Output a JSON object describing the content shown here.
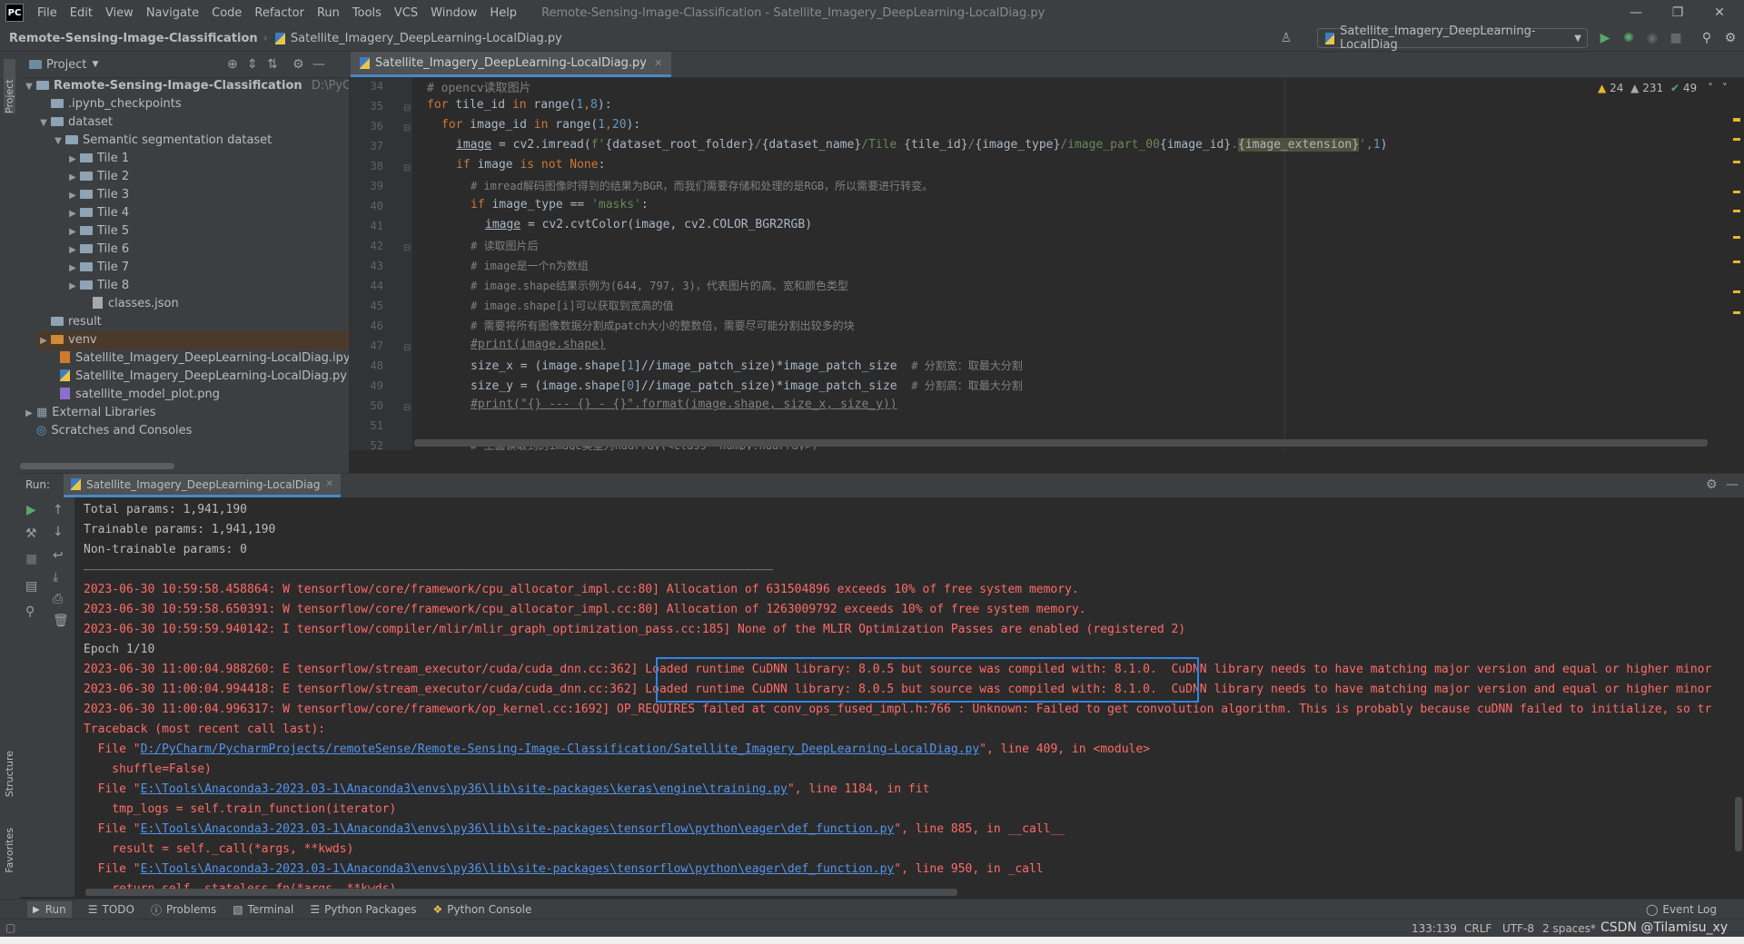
{
  "menu": {
    "items": [
      "File",
      "Edit",
      "View",
      "Navigate",
      "Code",
      "Refactor",
      "Run",
      "Tools",
      "VCS",
      "Window",
      "Help"
    ],
    "window_title": "Remote-Sensing-Image-Classification - Satellite_Imagery_DeepLearning-LocalDiag.py"
  },
  "navbar": {
    "project": "Remote-Sensing-Image-Classification",
    "file": "Satellite_Imagery_DeepLearning-LocalDiag.py",
    "run_config": "Satellite_Imagery_DeepLearning-LocalDiag"
  },
  "side_tabs": {
    "project": "Project",
    "structure": "Structure",
    "favorites": "Favorites"
  },
  "project_panel": {
    "title": "Project",
    "root_name": "Remote-Sensing-Image-Classification",
    "root_path": "D:\\PyCharm\\Py",
    "items": {
      "checkpoints": ".ipynb_checkpoints",
      "dataset": "dataset",
      "semantic": "Semantic segmentation dataset",
      "tile1": "Tile 1",
      "tile2": "Tile 2",
      "tile3": "Tile 3",
      "tile4": "Tile 4",
      "tile5": "Tile 5",
      "tile6": "Tile 6",
      "tile7": "Tile 7",
      "tile8": "Tile 8",
      "classes": "classes.json",
      "result": "result",
      "venv": "venv",
      "ipynb": "Satellite_Imagery_DeepLearning-LocalDiag.ipynb",
      "py": "Satellite_Imagery_DeepLearning-LocalDiag.py",
      "png": "satellite_model_plot.png",
      "ext_libs": "External Libraries",
      "scratches": "Scratches and Consoles"
    }
  },
  "editor": {
    "tab": "Satellite_Imagery_DeepLearning-LocalDiag.py",
    "inspections": {
      "warn1": "24",
      "warn2": "231",
      "ok": "49"
    },
    "line_numbers": [
      "34",
      "35",
      "36",
      "37",
      "38",
      "39",
      "40",
      "41",
      "42",
      "43",
      "44",
      "45",
      "46",
      "47",
      "48",
      "49",
      "50",
      "51",
      "52"
    ],
    "lines": {
      "l34": "# opencv读取图片",
      "l35_a": "for",
      "l35_b": " tile_id ",
      "l35_c": "in",
      "l35_d": " range(",
      "l35_e": "1",
      "l35_f": ",",
      "l35_g": "8",
      "l35_h": "):",
      "l36_a": "for",
      "l36_b": " image_id ",
      "l36_c": "in",
      "l36_d": " range(",
      "l36_e": "1",
      "l36_f": ",",
      "l36_g": "20",
      "l36_h": "):",
      "l37_a": "image",
      "l37_b": " = cv2.imread(",
      "l37_c": "f'",
      "l37_d": "{dataset_root_folder}",
      "l37_e": "/",
      "l37_f": "{dataset_name}",
      "l37_g": "/Tile ",
      "l37_h": "{tile_id}",
      "l37_i": "/",
      "l37_j": "{image_type}",
      "l37_k": "/image_part_00",
      "l37_l": "{image_id}",
      "l37_m": ".",
      "l37_n": "{image_extension}",
      "l37_o": "'",
      "l37_p": ",",
      "l37_q": "1",
      "l37_r": ")",
      "l38_a": "if",
      "l38_b": " image ",
      "l38_c": "is not",
      "l38_d": " None",
      "l38_e": ":",
      "l39": "# imread解码图像时得到的结果为BGR，而我们需要存储和处理的是RGB，所以需要进行转变。",
      "l40_a": "if",
      "l40_b": " image_type == ",
      "l40_c": "'masks'",
      "l40_d": ":",
      "l41_a": "image",
      "l41_b": " = cv2.cvtColor(image, cv2.COLOR_BGR2RGB)",
      "l42": "# 读取图片后",
      "l43": "# image是一个n为数组",
      "l44": "# image.shape结果示例为(644, 797, 3)，代表图片的高、宽和颜色类型",
      "l45": "# image.shape[i]可以获取到宽高的值",
      "l46": "# 需要将所有图像数据分割成patch大小的整数倍，需要尽可能分割出较多的块",
      "l47": "#print(image.shape)",
      "l48_a": "size_x = (image.shape[",
      "l48_b": "1",
      "l48_c": "]//image_patch_size)*image_patch_size  ",
      "l48_d": "# 分割宽：取最大分割",
      "l49_a": "size_y = (image.shape[",
      "l49_b": "0",
      "l49_c": "]//image_patch_size)*image_patch_size  ",
      "l49_d": "# 分割高：取最大分割",
      "l50": "#print(\"{} --- {} - {}\".format(image.shape, size_x, size_y))",
      "l52": "# 上面读取到的image类型为ndarray(<class 'numpy.ndarray>)"
    }
  },
  "run_panel": {
    "label": "Run:",
    "tab": "Satellite_Imagery_DeepLearning-LocalDiag",
    "output": {
      "o1": "Total params: 1,941,190",
      "o2": "Trainable params: 1,941,190",
      "o3": "Non-trainable params: 0",
      "o4": "_________________________________________________________________________________________________",
      "o5": "2023-06-30 10:59:58.458864: W tensorflow/core/framework/cpu_allocator_impl.cc:80] Allocation of 631504896 exceeds 10% of free system memory.",
      "o6": "2023-06-30 10:59:58.650391: W tensorflow/core/framework/cpu_allocator_impl.cc:80] Allocation of 1263009792 exceeds 10% of free system memory.",
      "o7": "2023-06-30 10:59:59.940142: I tensorflow/compiler/mlir/mlir_graph_optimization_pass.cc:185] None of the MLIR Optimization Passes are enabled (registered 2)",
      "o8": "Epoch 1/10",
      "o9": "2023-06-30 11:00:04.988260: E tensorflow/stream_executor/cuda/cuda_dnn.cc:362] Loaded runtime CuDNN library: 8.0.5 but source was compiled with: 8.1.0.  CuDNN library needs to have matching major version and equal or higher minor",
      "o10": "2023-06-30 11:00:04.994418: E tensorflow/stream_executor/cuda/cuda_dnn.cc:362] Loaded runtime CuDNN library: 8.0.5 but source was compiled with: 8.1.0.  CuDNN library needs to have matching major version and equal or higher minor",
      "o11": "2023-06-30 11:00:04.996317: W tensorflow/core/framework/op_kernel.cc:1692] OP_REQUIRES failed at conv_ops_fused_impl.h:766 : Unknown: Failed to get convolution algorithm. This is probably because cuDNN failed to initialize, so tr",
      "o12": "Traceback (most recent call last):",
      "o13_a": "  File \"",
      "o13_b": "D:/PyCharm/PycharmProjects/remoteSense/Remote-Sensing-Image-Classification/Satellite_Imagery_DeepLearning-LocalDiag.py",
      "o13_c": "\", line 409, in <module>",
      "o14": "    shuffle=False)",
      "o15_a": "  File \"",
      "o15_b": "E:\\Tools\\Anaconda3-2023.03-1\\Anaconda3\\envs\\py36\\lib\\site-packages\\keras\\engine\\training.py",
      "o15_c": "\", line 1184, in fit",
      "o16": "    tmp_logs = self.train_function(iterator)",
      "o17_a": "  File \"",
      "o17_b": "E:\\Tools\\Anaconda3-2023.03-1\\Anaconda3\\envs\\py36\\lib\\site-packages\\tensorflow\\python\\eager\\def_function.py",
      "o17_c": "\", line 885, in __call__",
      "o18": "    result = self._call(*args, **kwds)",
      "o19_a": "  File \"",
      "o19_b": "E:\\Tools\\Anaconda3-2023.03-1\\Anaconda3\\envs\\py36\\lib\\site-packages\\tensorflow\\python\\eager\\def_function.py",
      "o19_c": "\", line 950, in _call",
      "o20": "    return self._stateless_fn(*args, **kwds)"
    }
  },
  "bottom_tools": {
    "run": "Run",
    "todo": "TODO",
    "problems": "Problems",
    "terminal": "Terminal",
    "packages": "Python Packages",
    "console": "Python Console",
    "event_log": "Event Log"
  },
  "status": {
    "position": "133:139",
    "line_sep": "CRLF",
    "encoding": "UTF-8",
    "indent": "2 spaces*",
    "watermark": "CSDN @Tilamisu_xy"
  },
  "colors": {
    "highlight_box": "#2f86e8",
    "error_text": "#ff6b68",
    "link": "#5394ec"
  }
}
